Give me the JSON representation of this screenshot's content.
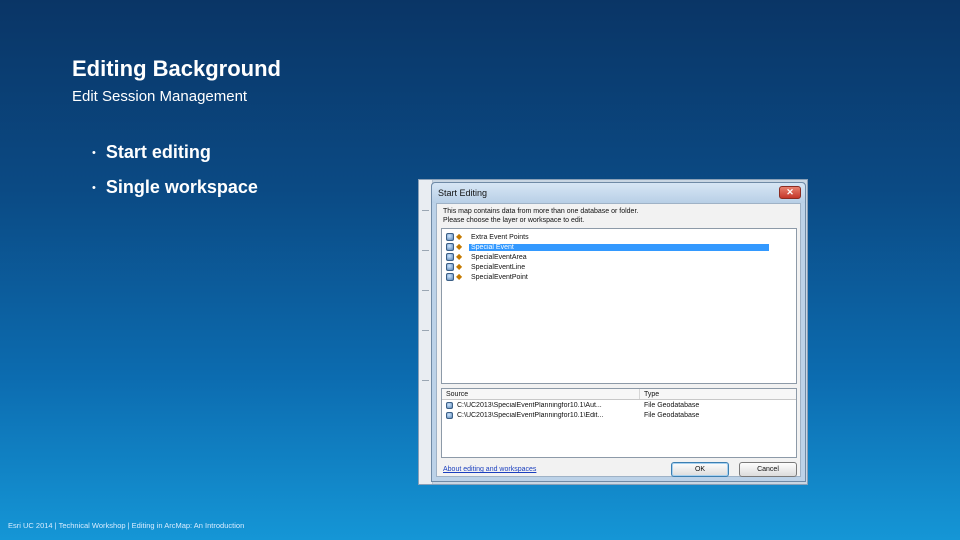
{
  "slide": {
    "title": "Editing Background",
    "subtitle": "Edit Session Management",
    "bullets": [
      "Start editing",
      "Single workspace"
    ],
    "bullet_glyph": "•",
    "footer": "Esri UC 2014 | Technical Workshop | Editing in ArcMap: An Introduction"
  },
  "dialog": {
    "title": "Start Editing",
    "close_glyph": "✕",
    "message_line1": "This map contains data from more than one database or folder.",
    "message_line2": "Please choose the layer or workspace to edit.",
    "layers": [
      {
        "label": "Extra Event Points",
        "selected": false
      },
      {
        "label": "Special Event",
        "selected": true
      },
      {
        "label": "SpecialEventArea",
        "selected": false
      },
      {
        "label": "SpecialEventLine",
        "selected": false
      },
      {
        "label": "SpecialEventPoint",
        "selected": false
      }
    ],
    "table": {
      "headers": {
        "source": "Source",
        "type": "Type"
      },
      "rows": [
        {
          "source": "C:\\UC2013\\SpecialEventPlanningfor10.1\\Aut...",
          "type": "File Geodatabase"
        },
        {
          "source": "C:\\UC2013\\SpecialEventPlanningfor10.1\\Edit...",
          "type": "File Geodatabase"
        }
      ]
    },
    "help_link": "About editing and workspaces",
    "ok_label": "OK",
    "cancel_label": "Cancel",
    "layer_icon_glyph": "◆"
  },
  "colors": {
    "background_top": "#0a3566",
    "background_bottom": "#1596d6",
    "selection": "#3399ff",
    "link": "#1a3fbf"
  }
}
